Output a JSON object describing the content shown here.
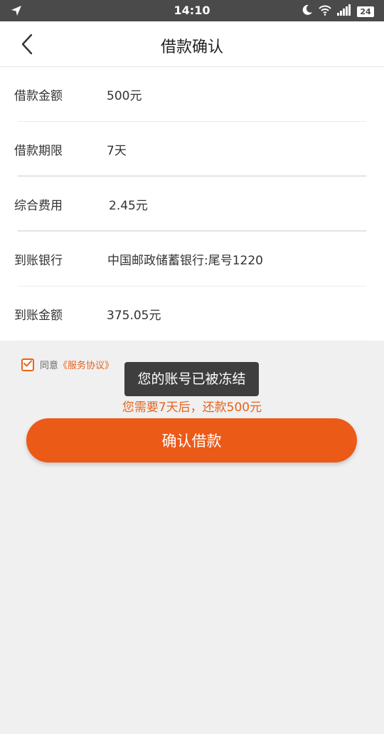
{
  "status_bar": {
    "time": "14:10",
    "battery": "24",
    "icons": [
      "navigation-arrow-icon",
      "moon-icon",
      "wifi-icon",
      "signal-icon",
      "battery-icon"
    ]
  },
  "header": {
    "title": "借款确认",
    "back_icon": "chevron-left-icon"
  },
  "details": [
    {
      "label": "借款金额",
      "value": "500元"
    },
    {
      "label": "借款期限",
      "value": "7天"
    },
    {
      "label": "综合费用",
      "value": "2.45元"
    },
    {
      "label": "到账银行",
      "value": "中国邮政储蓄银行:尾号1220"
    },
    {
      "label": "到账金额",
      "value": "375.05元"
    }
  ],
  "agreement": {
    "checked": true,
    "prefix": "同意",
    "link": "《服务协议》"
  },
  "toast": "您的账号已被冻结",
  "notice": "您需要7天后，还款500元",
  "confirm_button": "确认借款",
  "colors": {
    "accent": "#ec5a18",
    "status_bar": "#4a4a4a",
    "toast": "#3e3e3e",
    "background": "#f0f0f0"
  }
}
